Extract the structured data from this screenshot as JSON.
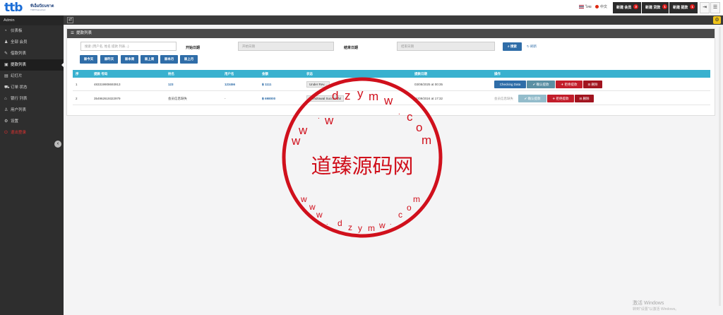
{
  "brand": {
    "logo_text": "ttb",
    "tagline": "ทีเอ็มบีธนชาต",
    "subtagline": "TMBThanachart"
  },
  "topbar": {
    "lang_thai": "ไทย",
    "lang_chinese": "中文",
    "new_members": {
      "label": "新建 会员",
      "count": "3"
    },
    "new_withdrawals": {
      "label": "新建 贷款",
      "count": "1"
    },
    "new_loans": {
      "label": "新建 提款",
      "count": "1"
    }
  },
  "sidebar": {
    "role": "Admin",
    "items": [
      {
        "label": "仪表板",
        "icon": "dashboard-icon"
      },
      {
        "label": "全部 会员",
        "icon": "users-icon"
      },
      {
        "label": "借款列表",
        "icon": "edit-icon"
      },
      {
        "label": "提款列表",
        "icon": "money-icon",
        "active": true
      },
      {
        "label": "幻灯片",
        "icon": "slides-icon"
      },
      {
        "label": "订单 状态",
        "icon": "cart-icon"
      },
      {
        "label": "银行 列表",
        "icon": "bank-icon"
      },
      {
        "label": "用户列表",
        "icon": "user-icon"
      },
      {
        "label": "设置",
        "icon": "gear-icon"
      },
      {
        "label": "退出登录",
        "icon": "power-icon",
        "danger": true
      }
    ]
  },
  "panel": {
    "title": "提款列表",
    "search_placeholder": "搜索 (用户名, 姓名 提款 列表...)",
    "start_label": "开始日期",
    "start_placeholder": "开始日期",
    "end_label": "结束日期",
    "end_placeholder": "结束日期",
    "search_button": "搜索",
    "refresh_button": "刷新",
    "range_buttons": [
      "今天",
      "昨天",
      "本周",
      "上周",
      "本月",
      "上月"
    ]
  },
  "table": {
    "headers": [
      "序",
      "提款 号码",
      "姓名",
      "用户名",
      "金额",
      "状态",
      "提款日期",
      "操作"
    ],
    "rows": [
      {
        "no": "1",
        "number": "483319908693913",
        "name": "123",
        "username": "123456",
        "amount": "฿ 1111",
        "status": "Under Rev...",
        "date": "03/08/2025 at 00:35",
        "action_note": "",
        "action_primary": "Checking Data"
      },
      {
        "no": "2",
        "number": "354962619322979",
        "name": "会员信息缺失",
        "username": "-",
        "amount": "฿ 698000",
        "status": "Withdrawal Successful",
        "date": "21/09/2024 at 17:32",
        "action_note": "会员信息缺失",
        "action_primary": ""
      }
    ],
    "btn_confirm": "确认提款",
    "btn_reject": "拒绝提款",
    "btn_delete": "删除"
  },
  "stamp": {
    "center": "道臻源码网",
    "ring_top": [
      "d",
      "z",
      "y",
      "m",
      "w",
      ".",
      "c",
      "o",
      "m"
    ],
    "ring_top_left": [
      "w",
      ".",
      "w",
      "w"
    ],
    "ring_bottom": [
      "w",
      "w",
      "w",
      ".",
      "d",
      "z",
      "y",
      "m",
      "w",
      ".",
      "c",
      "o",
      "m"
    ],
    "color": "#d0101c"
  },
  "watermark": {
    "line1": "激活 Windows",
    "line2": "转到\"设置\"以激活 Windows。"
  },
  "colors": {
    "accent": "#2f6da8",
    "table_header": "#39b1cf",
    "danger": "#c21d2a",
    "sidebar": "#2e2e2e"
  }
}
